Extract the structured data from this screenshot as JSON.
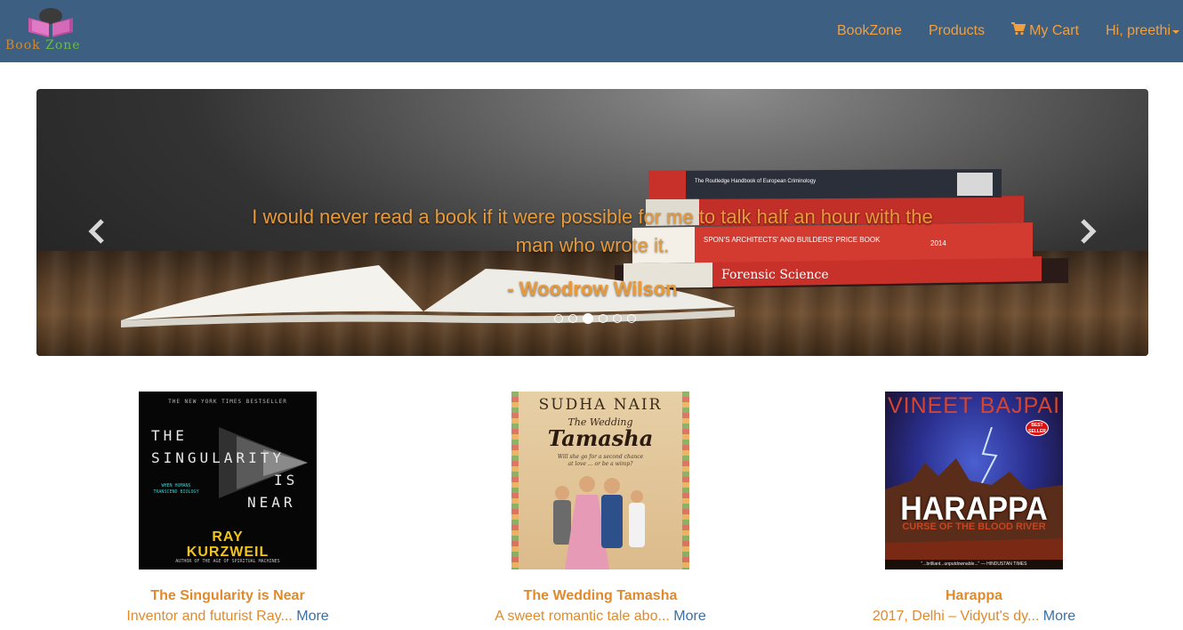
{
  "navbar": {
    "brand_word1": "Book",
    "brand_word2": "Zone",
    "links": {
      "home": "BookZone",
      "products": "Products",
      "cart": "My Cart",
      "user": "Hi, preethi"
    },
    "colors": {
      "background": "#3d5f82",
      "link": "#f0a040"
    }
  },
  "carousel": {
    "quote": "I would never read a book if it were possible for me to talk half an hour with the man who wrote it.",
    "author": "- Woodrow Wilson",
    "slide_count": 6,
    "active_slide": 3,
    "prev_icon": "chevron-left-icon",
    "next_icon": "chevron-right-icon",
    "stack_spines": [
      "The Routledge Handbook of European Criminology",
      "SPON'S ARCHITECTS' AND BUILDERS' PRICE BOOK",
      "2014",
      "Forensic Science"
    ]
  },
  "products": [
    {
      "title": "The Singularity is Near",
      "description": "Inventor and futurist Ray...",
      "more": "More",
      "cover": {
        "banner": "THE NEW YORK TIMES BESTSELLER",
        "title_lines": [
          "THE",
          "SINGULARITY",
          "IS",
          "NEAR"
        ],
        "subtitle": "WHEN HUMANS TRANSCEND BIOLOGY",
        "author_line1": "RAY",
        "author_line2": "KURZWEIL",
        "footer": "AUTHOR OF THE AGE OF SPIRITUAL MACHINES"
      }
    },
    {
      "title": "The Wedding Tamasha",
      "description": "A sweet romantic tale abo...",
      "more": "More",
      "cover": {
        "author": "SUDHA NAIR",
        "title_prefix": "The Wedding",
        "title_main": "Tamasha",
        "tagline": "Will she go for a second chance at love ... or be a wimp?"
      }
    },
    {
      "title": "Harappa",
      "description": "2017, Delhi – Vidyut's dy...",
      "more": "More",
      "cover": {
        "author": "VINEET BAJPAI",
        "badge": "BEST SELLER",
        "title": "HARAPPA",
        "subtitle": "CURSE OF THE BLOOD RIVER",
        "footer": "\"...brilliant...unputdownable...\" — HINDUSTAN TIMES"
      }
    }
  ],
  "colors": {
    "accent": "#e08a2c",
    "more_link": "#3b6fa6"
  }
}
